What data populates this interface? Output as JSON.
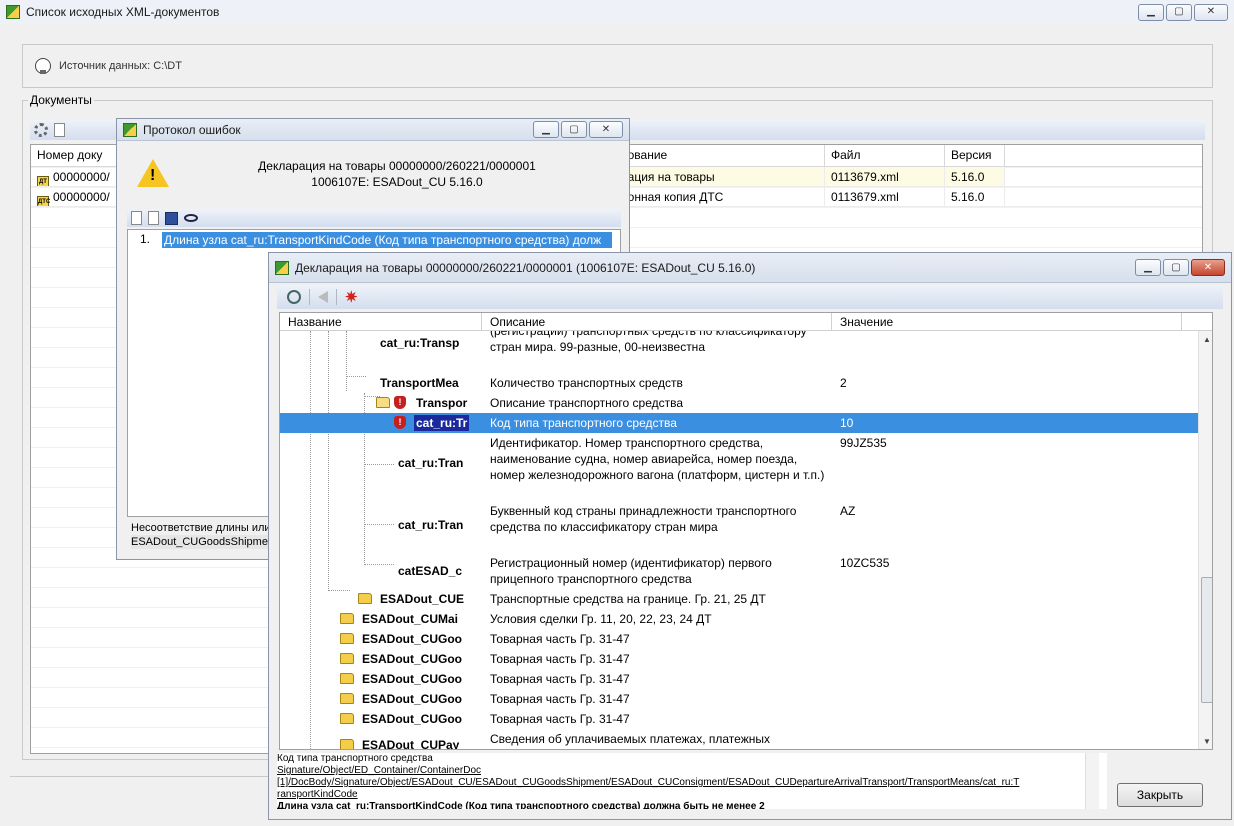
{
  "main": {
    "title": "Список исходных XML-документов",
    "source_label": "Источник данных: C:\\DT",
    "documents_label": "Документы",
    "columns": [
      "Номер доку",
      "нование",
      "Файл",
      "Версия"
    ],
    "rows": [
      {
        "icon": "ДТ",
        "number": "00000000/",
        "name": "рация на товары",
        "file": "0113679.xml",
        "version": "5.16.0"
      },
      {
        "icon": "ДТС",
        "number": "00000000/",
        "name": "ронная копия ДТС",
        "file": "0113679.xml",
        "version": "5.16.0"
      }
    ]
  },
  "errors": {
    "title": "Протокол ошибок",
    "header_line1": "Декларация на товары 00000000/260221/0000001",
    "header_line2": "1006107E: ESADout_CU 5.16.0",
    "items": [
      {
        "num": "1.",
        "text": "Длина узла cat_ru:TransportKindCode (Код типа транспортного средства) долж"
      }
    ],
    "status_line1": "Несоответствие длины или",
    "status_line2": "ESADout_CUGoodsShipmen"
  },
  "decl": {
    "title": "Декларация на товары 00000000/260221/0000001 (1006107E: ESADout_CU 5.16.0)",
    "columns": {
      "name": "Название",
      "desc": "Описание",
      "value": "Значение"
    },
    "rows": [
      {
        "name": "cat_ru:Transp",
        "desc": "(регистрации) транспортных средств по классификатору стран мира. 99-разные, 00-неизвестна",
        "value": ""
      },
      {
        "name": "TransportMea",
        "desc": "Количество транспортных средств",
        "value": "2"
      },
      {
        "name": "Transpor",
        "desc": "Описание транспортного средства",
        "value": ""
      },
      {
        "name": "cat_ru:Tr",
        "desc": "Код типа транспортного средства",
        "value": "10"
      },
      {
        "name": "cat_ru:Tran",
        "desc": "Идентификатор. Номер транспортного средства, наименование судна, номер авиарейса, номер поезда, номер железнодорожного вагона (платформ, цистерн и т.п.)",
        "value": "99JZ535"
      },
      {
        "name": "cat_ru:Tran",
        "desc": "Буквенный код страны принадлежности транспортного средства по классификатору стран мира",
        "value": "AZ"
      },
      {
        "name": "catESAD_c",
        "desc": "Регистрационный номер (идентификатор) первого прицепного транспортного средства",
        "value": "10ZC535"
      },
      {
        "name": "ESADout_CUE",
        "desc": "Транспортные средства на границе. Гр. 21, 25 ДТ",
        "value": ""
      },
      {
        "name": "ESADout_CUMai",
        "desc": "Условия сделки Гр. 11, 20, 22, 23, 24 ДТ",
        "value": ""
      },
      {
        "name": "ESADout_CUGoo",
        "desc": "Товарная часть Гр. 31-47",
        "value": ""
      },
      {
        "name": "ESADout_CUGoo",
        "desc": "Товарная часть Гр. 31-47",
        "value": ""
      },
      {
        "name": "ESADout_CUGoo",
        "desc": "Товарная часть Гр. 31-47",
        "value": ""
      },
      {
        "name": "ESADout_CUGoo",
        "desc": "Товарная часть Гр. 31-47",
        "value": ""
      },
      {
        "name": "ESADout_CUGoo",
        "desc": "Товарная часть Гр. 31-47",
        "value": ""
      },
      {
        "name": "ESADout_CUPay",
        "desc": "Сведения об уплачиваемых платежах, платежных",
        "value": ""
      }
    ],
    "bottom_title": "Код типа транспортного средства",
    "bottom_path1": "Signature/Object/ED_Container/ContainerDoc",
    "bottom_path2": "[1]/DocBody/Signature/Object/ESADout_CU/ESADout_CUGoodsShipment/ESADout_CUConsigment/ESADout_CUDepartureArrivalTransport/TransportMeans/cat_ru:T",
    "bottom_path3": "ransportKindCode",
    "bottom_error": "Длина узла cat_ru:TransportKindCode (Код типа транспортного средства) должна быть не менее 2",
    "close_label": "Закрыть"
  }
}
